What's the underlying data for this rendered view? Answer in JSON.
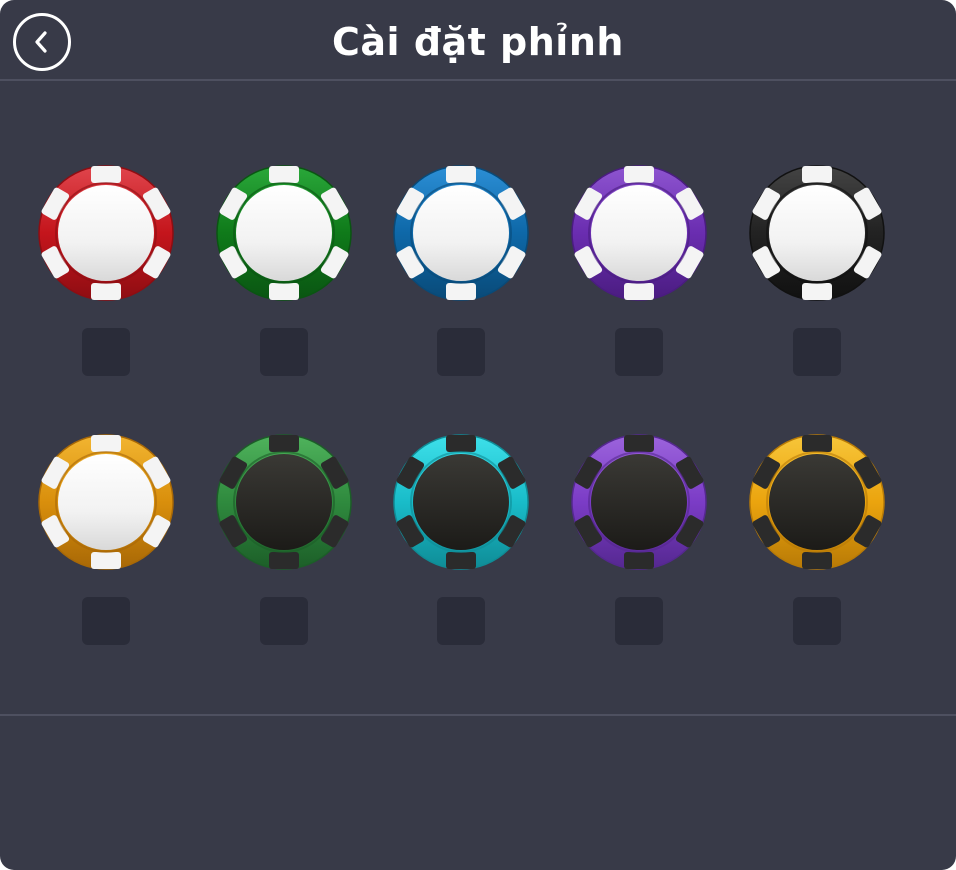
{
  "header": {
    "title": "Cài đặt phỉnh",
    "back_icon": "chevron-left-icon"
  },
  "chips": [
    {
      "id": "red",
      "rim": "#c4151c",
      "rim_light": "#e0454c",
      "rim_dark": "#8e0d12",
      "stripe": "#f4f4f4",
      "center": "light",
      "checked": false
    },
    {
      "id": "green",
      "rim": "#0f7a1a",
      "rim_light": "#2aa83a",
      "rim_dark": "#0a5512",
      "stripe": "#f4f4f4",
      "center": "light",
      "checked": false
    },
    {
      "id": "blue",
      "rim": "#0e68a8",
      "rim_light": "#2c8fd6",
      "rim_dark": "#094a78",
      "stripe": "#f4f4f4",
      "center": "light",
      "checked": false
    },
    {
      "id": "purple",
      "rim": "#6a2db0",
      "rim_light": "#8e55d0",
      "rim_dark": "#4a1c80",
      "stripe": "#f4f4f4",
      "center": "light",
      "checked": false
    },
    {
      "id": "black",
      "rim": "#222222",
      "rim_light": "#444444",
      "rim_dark": "#111111",
      "stripe": "#f4f4f4",
      "center": "light",
      "checked": false
    },
    {
      "id": "orange",
      "rim": "#d98f0c",
      "rim_light": "#f2b531",
      "rim_dark": "#a86806",
      "stripe": "#f4f4f4",
      "center": "light",
      "checked": false
    },
    {
      "id": "dark-green",
      "rim": "#2f8a3e",
      "rim_light": "#4fb35c",
      "rim_dark": "#1c5e28",
      "stripe": "#2b2b2b",
      "center": "dark",
      "checked": false
    },
    {
      "id": "cyan",
      "rim": "#19bcc9",
      "rim_light": "#3ee0ea",
      "rim_dark": "#0f8c96",
      "stripe": "#2b2b2b",
      "center": "dark",
      "checked": false
    },
    {
      "id": "dark-purple",
      "rim": "#7b3cc6",
      "rim_light": "#9c64dc",
      "rim_dark": "#552890",
      "stripe": "#2b2b2b",
      "center": "dark",
      "checked": false
    },
    {
      "id": "gold",
      "rim": "#eba40e",
      "rim_light": "#f7c63a",
      "rim_dark": "#b87a06",
      "stripe": "#2b2b2b",
      "center": "dark",
      "checked": false
    }
  ]
}
